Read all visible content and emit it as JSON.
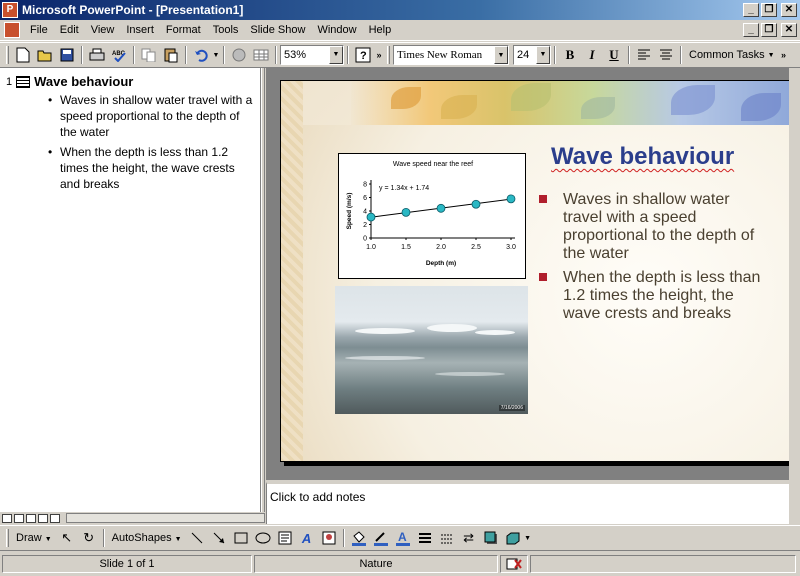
{
  "window": {
    "title": "Microsoft PowerPoint - [Presentation1]",
    "app_icon_letter": "P",
    "controls": [
      "_",
      "❐",
      "✕"
    ]
  },
  "menu": {
    "items": [
      "File",
      "Edit",
      "View",
      "Insert",
      "Format",
      "Tools",
      "Slide Show",
      "Window",
      "Help"
    ],
    "doc_controls": [
      "_",
      "❐",
      "✕"
    ]
  },
  "toolbar": {
    "zoom": "53%",
    "font_name": "Times New Roman",
    "font_size": "24",
    "bold": "B",
    "italic": "I",
    "underline": "U",
    "common_tasks": "Common Tasks"
  },
  "outline": {
    "slide_number": "1",
    "title": "Wave behaviour",
    "bullets": [
      "Waves in shallow water travel with a speed proportional to the depth of the water",
      "When the depth is less than 1.2 times the height, the wave crests and breaks"
    ]
  },
  "slide": {
    "title": "Wave behaviour",
    "bullets": [
      "Waves in shallow water travel with a speed proportional to the depth of the water",
      "When the depth is less than 1.2 times the height, the wave crests and breaks"
    ],
    "photo_date": "7/16/2006",
    "title_color": "#2b3e8c",
    "bullet_color": "#b01e2c"
  },
  "chart_data": {
    "type": "scatter",
    "title": "Wave speed near the reef",
    "xlabel": "Depth (m)",
    "ylabel": "Speed (m/s)",
    "equation": "y = 1.34x + 1.74",
    "xlim": [
      1.0,
      3.0
    ],
    "ylim": [
      0,
      8
    ],
    "xticks": [
      "1.0",
      "1.5",
      "2.0",
      "2.5",
      "3.0"
    ],
    "yticks": [
      "0",
      "2",
      "4",
      "6",
      "8"
    ],
    "x": [
      1.0,
      1.5,
      2.0,
      2.5,
      3.0
    ],
    "y": [
      3.1,
      3.8,
      4.4,
      5.0,
      5.8
    ],
    "trendline": {
      "slope": 1.34,
      "intercept": 1.74
    },
    "marker_color": "#2ab8c4"
  },
  "notes": {
    "placeholder": "Click to add notes"
  },
  "drawbar": {
    "draw": "Draw",
    "autoshapes": "AutoShapes"
  },
  "status": {
    "slide": "Slide 1 of 1",
    "design": "Nature"
  }
}
